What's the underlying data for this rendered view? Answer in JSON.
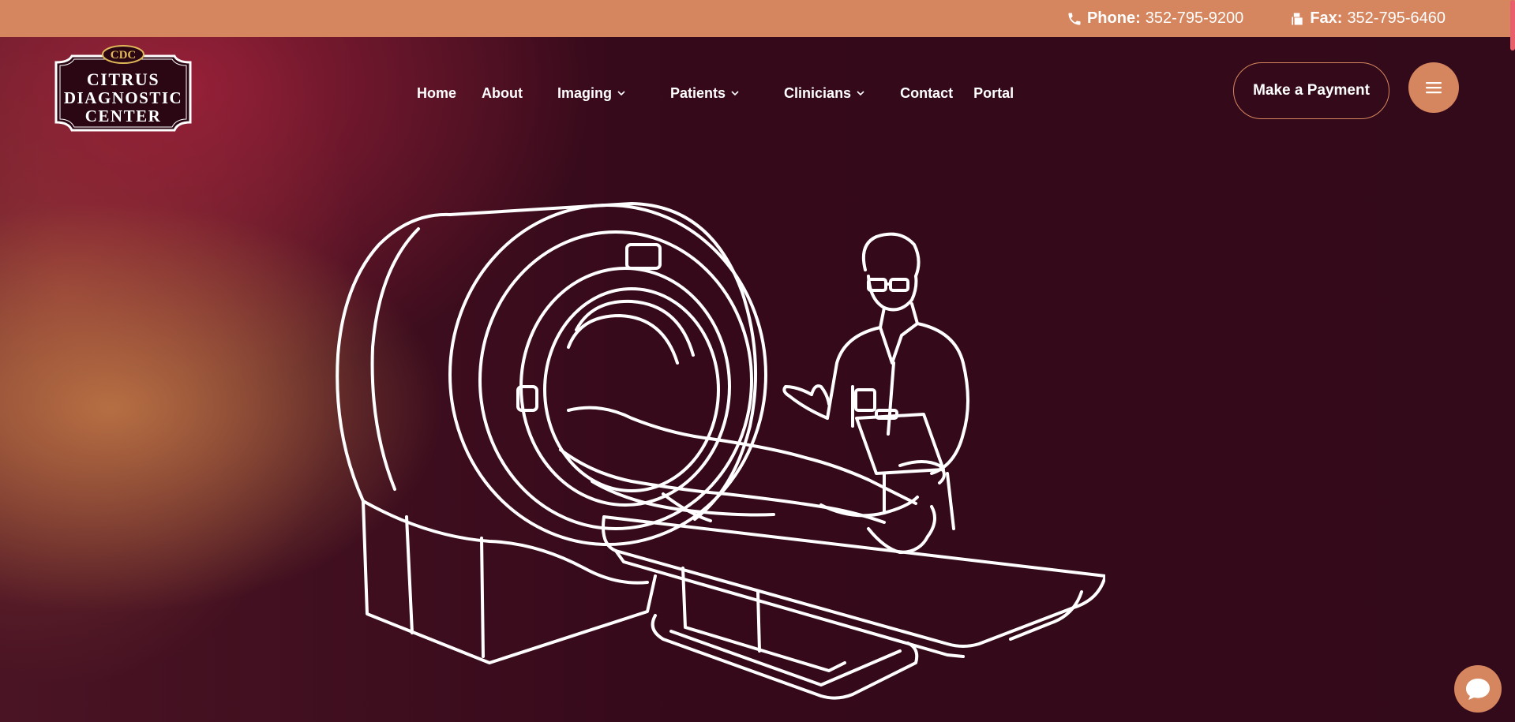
{
  "topbar": {
    "phone_label": "Phone:",
    "phone_value": "352-795-9200",
    "fax_label": "Fax:",
    "fax_value": "352-795-6460"
  },
  "logo": {
    "badge": "CDC",
    "line1": "CITRUS",
    "line2": "DIAGNOSTIC",
    "line3": "CENTER"
  },
  "nav": {
    "items": [
      {
        "label": "Home",
        "dropdown": false
      },
      {
        "label": "About",
        "dropdown": false
      },
      {
        "label": "Imaging",
        "dropdown": true
      },
      {
        "label": "Patients",
        "dropdown": true
      },
      {
        "label": "Clinicians",
        "dropdown": true
      },
      {
        "label": "Contact",
        "dropdown": false
      },
      {
        "label": "Portal",
        "dropdown": false
      }
    ]
  },
  "actions": {
    "payment_label": "Make a Payment",
    "menu_icon": "hamburger-icon",
    "chat_icon": "chat-bubble-icon"
  },
  "hero": {
    "illustration": "mri-scanner-line-art"
  },
  "colors": {
    "accent": "#d6865f",
    "background": "#330a1a",
    "text": "#ffffff"
  }
}
